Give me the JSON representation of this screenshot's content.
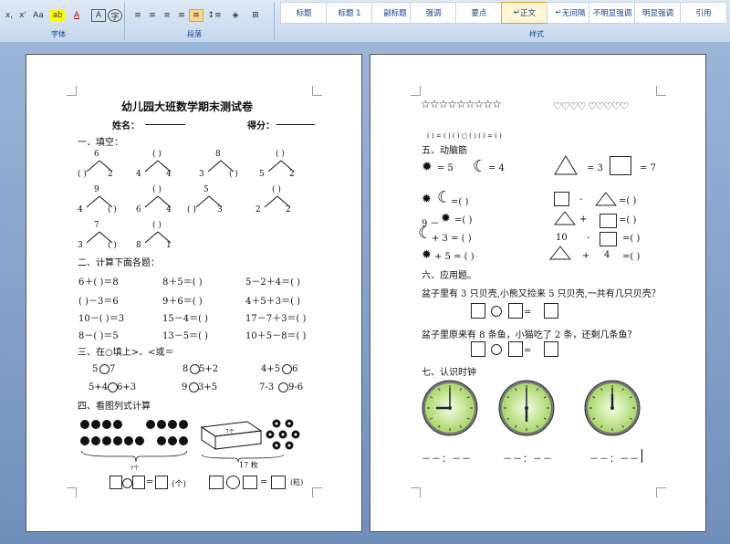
{
  "ribbon": {
    "font_group": "字体",
    "paragraph_group": "段落",
    "styles_group": "样式",
    "font_buttons": [
      "x,",
      "x'",
      "Aa",
      "ab",
      "A",
      "A",
      "字"
    ],
    "styles": [
      "标题",
      "标题 1",
      "副标题",
      "强调",
      "要点",
      "正文",
      "无间隔",
      "不明显强调",
      "明显强调",
      "引用"
    ],
    "selected_style": "正文"
  },
  "page1": {
    "title": "幼儿园大班数学期末测试卷",
    "name_label": "姓名：",
    "score_label": "得分：",
    "sec1": "一．填空：",
    "decomp": [
      {
        "top": "6",
        "l": "(  )",
        "r": "2"
      },
      {
        "top": "(  )",
        "l": "4",
        "r": "4"
      },
      {
        "top": "8",
        "l": "3",
        "r": "(  )"
      },
      {
        "top": "(  )",
        "l": "5",
        "r": "2"
      },
      {
        "top": "9",
        "l": "4",
        "r": "(  )"
      },
      {
        "top": "(  )",
        "l": "6",
        "r": "4"
      },
      {
        "top": "5",
        "l": "(  )",
        "r": "3"
      },
      {
        "top": "(  )",
        "l": "2",
        "r": "2"
      },
      {
        "top": "7",
        "l": "3",
        "r": "(  )"
      },
      {
        "top": "(  )",
        "l": "8",
        "r": "1"
      }
    ],
    "sec2": "二、计算下面各题：",
    "calc": [
      [
        "6＋(  )＝8",
        "8＋5＝(  )",
        "5－2＋4＝(  )"
      ],
      [
        "(  )－3＝6",
        "9＋6＝(  )",
        "4＋5＋3＝(  )"
      ],
      [
        "10－(  )＝3",
        "15－4＝(  )",
        "17－7＋3＝(  )"
      ],
      [
        "8－(  )＝5",
        "13－5＝(  )",
        "10＋5－8＝(  )"
      ]
    ],
    "sec3": "三、在○填上>、<或＝",
    "compare": [
      [
        "5",
        "7",
        "8",
        "5+2",
        "4+5",
        "6"
      ],
      [
        "5+4",
        "6+3",
        "9",
        "3+5",
        "7-3",
        "9-6"
      ]
    ],
    "sec4": "四、看图列式计算",
    "apple_label": "?个",
    "box_label": "7个",
    "brace_label": "17 枚",
    "unit1": "(个)",
    "unit2": "(粒)"
  },
  "page2": {
    "sec5": "五、动脑筋",
    "shape_values": {
      "sun": "= 5",
      "moon": "= 4",
      "triangle": "= 3",
      "square": "= 7"
    },
    "left_rows": [
      "=(   )",
      "9 －",
      "=(   )",
      "+ 3 = (   )",
      "+ 5 = (   )"
    ],
    "right_rows": [
      "-",
      "=(   )",
      "+",
      "=(   )",
      "10",
      "-",
      "=(   )",
      "+",
      "4",
      "=(   )"
    ],
    "paren_row": "(  ) = (  )     (  ) ○ (  )     (  ) = (  )",
    "sec6": "六、应用题。",
    "q1": "盆子里有 3 只贝壳,小熊又捡来 5 只贝壳,一共有几只贝壳？",
    "q2": "盆子里原来有 8 条鱼，小猫吃了 2 条，还剩几条鱼？",
    "sec7": "七、认识时钟",
    "time_blank": "－－：－－"
  }
}
